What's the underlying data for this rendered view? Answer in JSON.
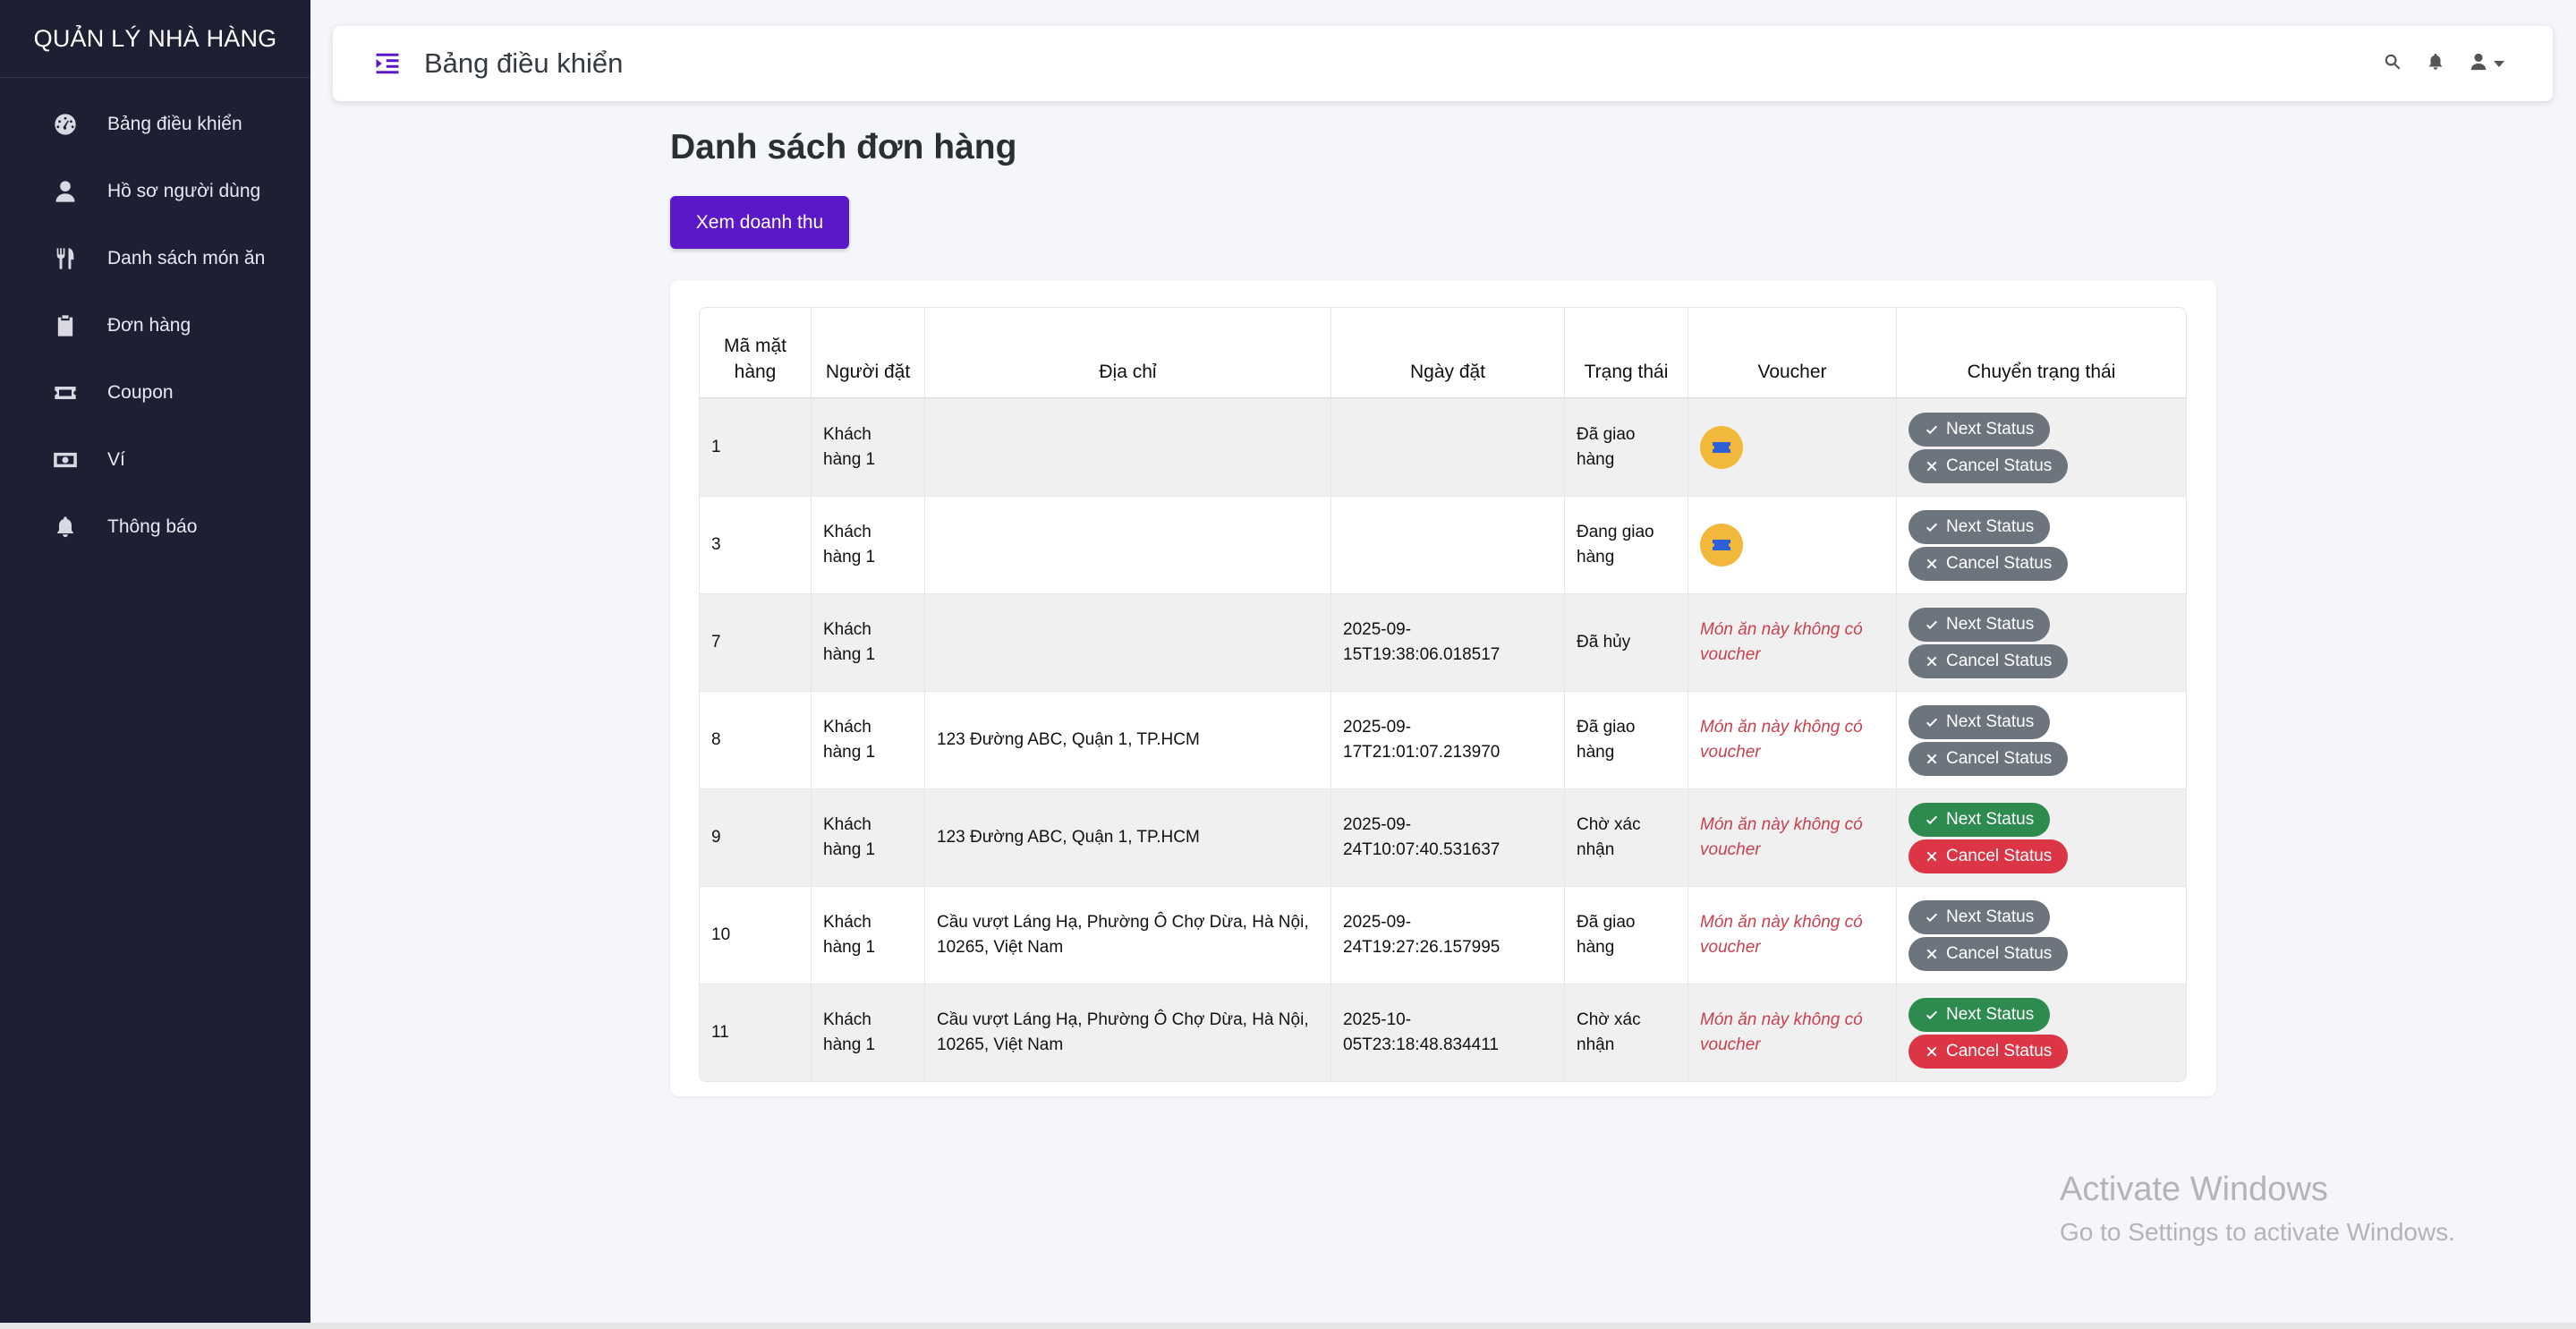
{
  "sidebar": {
    "brand": "QUẢN LÝ NHÀ HÀNG",
    "items": [
      {
        "label": "Bảng điều khiển",
        "icon": "dashboard-icon"
      },
      {
        "label": "Hồ sơ người dùng",
        "icon": "user-icon"
      },
      {
        "label": "Danh sách món ăn",
        "icon": "utensils-icon"
      },
      {
        "label": "Đơn hàng",
        "icon": "clipboard-icon"
      },
      {
        "label": "Coupon",
        "icon": "ticket-icon"
      },
      {
        "label": "Ví",
        "icon": "money-icon"
      },
      {
        "label": "Thông báo",
        "icon": "bell-icon"
      }
    ]
  },
  "header": {
    "title": "Bảng điều khiển",
    "icons": [
      "menu-toggle-icon",
      "search-icon",
      "bell-icon",
      "user-icon"
    ]
  },
  "main": {
    "title": "Danh sách đơn hàng",
    "revenue_button": "Xem doanh thu",
    "table": {
      "headers": [
        "Mã mặt hàng",
        "Người đặt",
        "Địa chỉ",
        "Ngày đặt",
        "Trạng thái",
        "Voucher",
        "Chuyển trạng thái"
      ],
      "next_label": "Next Status",
      "cancel_label": "Cancel Status",
      "no_voucher_text": "Món ăn này không có voucher",
      "rows": [
        {
          "id": "1",
          "customer": "Khách hàng 1",
          "address": "",
          "date": "",
          "status": "Đã giao hàng",
          "has_voucher": true,
          "active": false
        },
        {
          "id": "3",
          "customer": "Khách hàng 1",
          "address": "",
          "date": "",
          "status": "Đang giao hàng",
          "has_voucher": true,
          "active": false
        },
        {
          "id": "7",
          "customer": "Khách hàng 1",
          "address": "",
          "date": "2025-09-15T19:38:06.018517",
          "status": "Đã hủy",
          "has_voucher": false,
          "active": false
        },
        {
          "id": "8",
          "customer": "Khách hàng 1",
          "address": "123 Đường ABC, Quận 1, TP.HCM",
          "date": "2025-09-17T21:01:07.213970",
          "status": "Đã giao hàng",
          "has_voucher": false,
          "active": false
        },
        {
          "id": "9",
          "customer": "Khách hàng 1",
          "address": "123 Đường ABC, Quận 1, TP.HCM",
          "date": "2025-09-24T10:07:40.531637",
          "status": "Chờ xác nhận",
          "has_voucher": false,
          "active": true
        },
        {
          "id": "10",
          "customer": "Khách hàng 1",
          "address": "Cầu vượt Láng Hạ, Phường Ô Chợ Dừa, Hà Nội, 10265, Việt Nam",
          "date": "2025-09-24T19:27:26.157995",
          "status": "Đã giao hàng",
          "has_voucher": false,
          "active": false
        },
        {
          "id": "11",
          "customer": "Khách hàng 1",
          "address": "Cầu vượt Láng Hạ, Phường Ô Chợ Dừa, Hà Nội, 10265, Việt Nam",
          "date": "2025-10-05T23:18:48.834411",
          "status": "Chờ xác nhận",
          "has_voucher": false,
          "active": true
        }
      ]
    }
  },
  "watermark": {
    "line1": "Activate Windows",
    "line2": "Go to Settings to activate Windows."
  },
  "colors": {
    "sidebar_bg": "#1f1f33",
    "accent": "#5b18c8",
    "voucher": "#f1b83b",
    "success": "#2e8b4f",
    "danger": "#dc3545",
    "neutral": "#6c757d"
  }
}
